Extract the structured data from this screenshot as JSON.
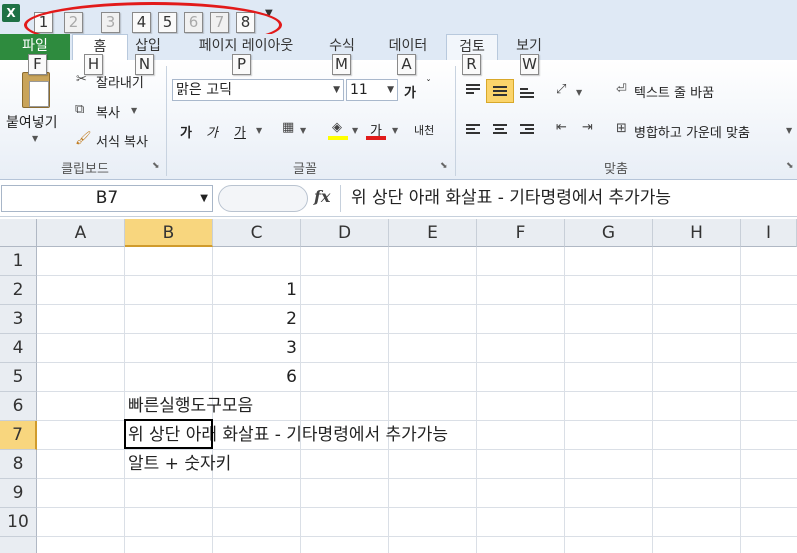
{
  "app": {
    "icon": "X"
  },
  "qat": {
    "keytips": [
      "1",
      "2",
      "3",
      "4",
      "5",
      "6",
      "7",
      "8"
    ]
  },
  "tabs": {
    "file": "파일",
    "home": "홈",
    "insert": "삽입",
    "page_layout": "페이지 레이아웃",
    "formulas": "수식",
    "data": "데이터",
    "review": "검토",
    "view": "보기"
  },
  "tab_keytips": {
    "file": "F",
    "home": "H",
    "insert": "N",
    "page_layout": "P",
    "formulas": "M",
    "data": "A",
    "review": "R",
    "view": "W"
  },
  "clipboard": {
    "paste": "붙여넣기",
    "cut": "잘라내기",
    "copy": "복사",
    "format_painter": "서식 복사",
    "label": "클립보드"
  },
  "font": {
    "name": "맑은 고딕",
    "size": "11",
    "bold": "가",
    "italic": "가",
    "underline": "가",
    "color_a": "가",
    "label": "글꼴",
    "grow": "가",
    "phonetic": "내천"
  },
  "alignment": {
    "wrap_text": "텍스트 줄 바꿈",
    "merge_center": "병합하고 가운데 맞춤",
    "label": "맞춤"
  },
  "formula_bar": {
    "name_box": "B7",
    "fx": "fx",
    "content": "위 상단 아래 화살표 - 기타명령에서 추가가능"
  },
  "columns": [
    "A",
    "B",
    "C",
    "D",
    "E",
    "F",
    "G",
    "H",
    "I"
  ],
  "rows": [
    "1",
    "2",
    "3",
    "4",
    "5",
    "6",
    "7",
    "8",
    "9",
    "10"
  ],
  "cells": {
    "C2": "1",
    "C3": "2",
    "C4": "3",
    "C5": "6",
    "B6": "빠른실행도구모음",
    "B7": "위 상단 아래 화살표 - 기타명령에서 추가가능",
    "B8": "알트 + 숫자키"
  },
  "colors": {
    "file_tab": "#2e8b3e",
    "annotation": "#e21a1a",
    "selection": "#f8d67e"
  }
}
